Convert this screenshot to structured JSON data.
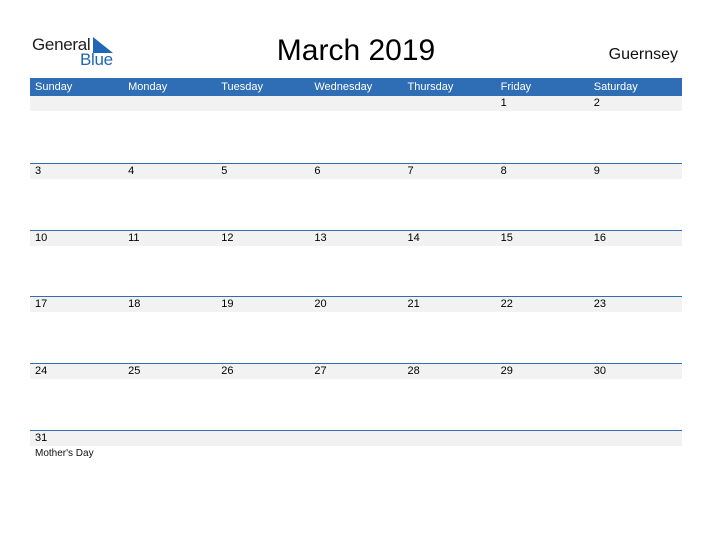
{
  "logo": {
    "word1": "General",
    "word2": "Blue",
    "mark_color": "#1f66b6"
  },
  "title": "March 2019",
  "region": "Guernsey",
  "colors": {
    "header_bg": "#2f6db4",
    "band_bg": "#f2f2f2"
  },
  "weekdays": [
    "Sunday",
    "Monday",
    "Tuesday",
    "Wednesday",
    "Thursday",
    "Friday",
    "Saturday"
  ],
  "weeks": [
    {
      "days": [
        "",
        "",
        "",
        "",
        "",
        "1",
        "2"
      ],
      "events": [
        "",
        "",
        "",
        "",
        "",
        "",
        ""
      ]
    },
    {
      "days": [
        "3",
        "4",
        "5",
        "6",
        "7",
        "8",
        "9"
      ],
      "events": [
        "",
        "",
        "",
        "",
        "",
        "",
        ""
      ]
    },
    {
      "days": [
        "10",
        "11",
        "12",
        "13",
        "14",
        "15",
        "16"
      ],
      "events": [
        "",
        "",
        "",
        "",
        "",
        "",
        ""
      ]
    },
    {
      "days": [
        "17",
        "18",
        "19",
        "20",
        "21",
        "22",
        "23"
      ],
      "events": [
        "",
        "",
        "",
        "",
        "",
        "",
        ""
      ]
    },
    {
      "days": [
        "24",
        "25",
        "26",
        "27",
        "28",
        "29",
        "30"
      ],
      "events": [
        "",
        "",
        "",
        "",
        "",
        "",
        ""
      ]
    },
    {
      "days": [
        "31",
        "",
        "",
        "",
        "",
        "",
        ""
      ],
      "events": [
        "Mother's Day",
        "",
        "",
        "",
        "",
        "",
        ""
      ]
    }
  ]
}
